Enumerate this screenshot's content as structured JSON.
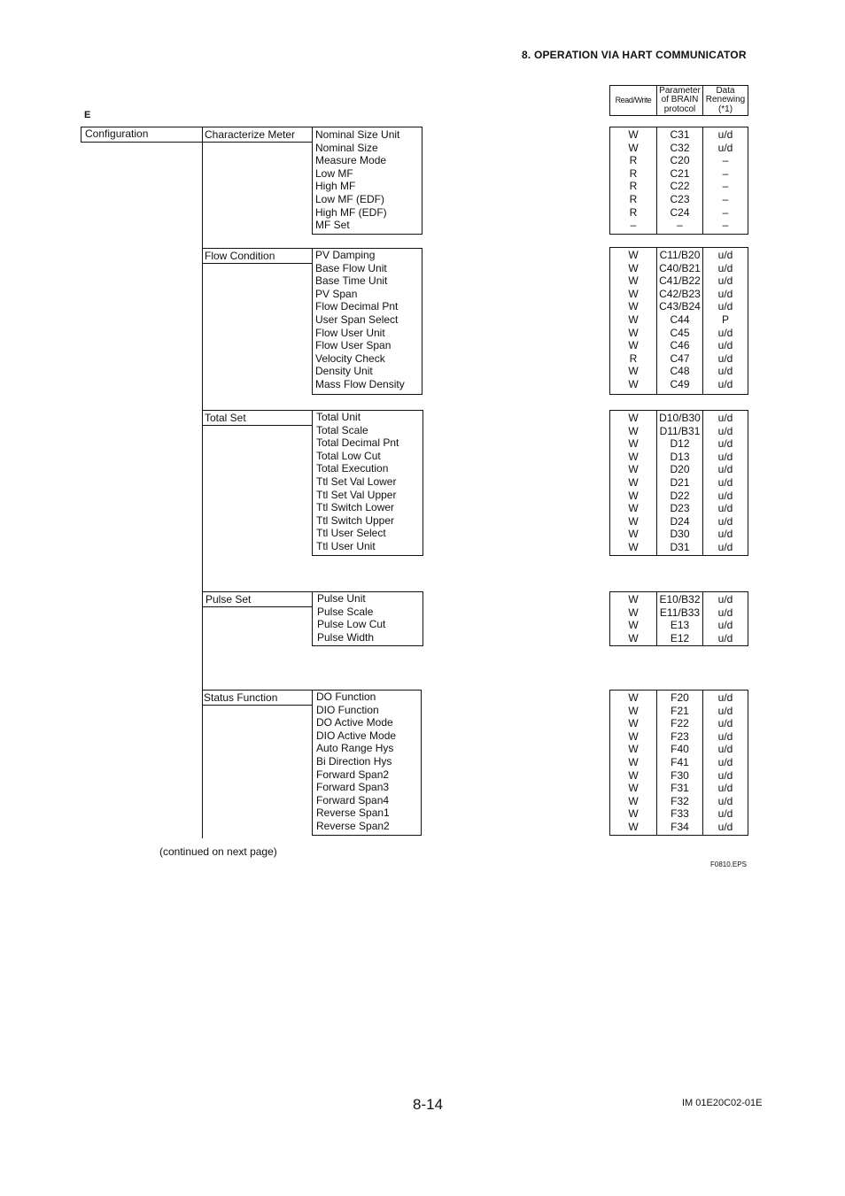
{
  "header": {
    "title": "8.  OPERATION VIA HART COMMUNICATOR"
  },
  "section_mark": "E",
  "table_header": {
    "read_write": "Read/Write",
    "brain_param": "Parameter of BRAIN protocol",
    "data_renewing": "Data Renewing (*1)"
  },
  "root": {
    "label": "Configuration"
  },
  "groups": [
    {
      "label": "Characterize Meter",
      "items": [
        "Nominal Size Unit",
        "Nominal Size",
        "Measure Mode",
        "Low MF",
        "High MF",
        "Low MF (EDF)",
        "High MF (EDF)",
        "MF Set"
      ],
      "rw": [
        "W",
        "W",
        "R",
        "R",
        "R",
        "R",
        "R",
        "–"
      ],
      "param": [
        "C31",
        "C32",
        "C20",
        "C21",
        "C22",
        "C23",
        "C24",
        "–"
      ],
      "renew": [
        "u/d",
        "u/d",
        "–",
        "–",
        "–",
        "–",
        "–",
        "–"
      ]
    },
    {
      "label": "Flow Condition",
      "items": [
        "PV Damping",
        "Base Flow Unit",
        "Base Time Unit",
        "PV Span",
        "Flow Decimal Pnt",
        "User Span Select",
        "Flow User Unit",
        "Flow User Span",
        "Velocity Check",
        "Density Unit",
        "Mass Flow Density"
      ],
      "rw": [
        "W",
        "W",
        "W",
        "W",
        "W",
        "W",
        "W",
        "W",
        "R",
        "W",
        "W"
      ],
      "param": [
        "C11/B20",
        "C40/B21",
        "C41/B22",
        "C42/B23",
        "C43/B24",
        "C44",
        "C45",
        "C46",
        "C47",
        "C48",
        "C49"
      ],
      "renew": [
        "u/d",
        "u/d",
        "u/d",
        "u/d",
        "u/d",
        "P",
        "u/d",
        "u/d",
        "u/d",
        "u/d",
        "u/d"
      ]
    },
    {
      "label": "Total Set",
      "items": [
        "Total Unit",
        "Total Scale",
        "Total Decimal Pnt",
        "Total Low Cut",
        "Total Execution",
        "Ttl Set Val Lower",
        "Ttl Set Val Upper",
        "Ttl Switch Lower",
        "Ttl Switch Upper",
        "Ttl User Select",
        "Ttl User Unit"
      ],
      "rw": [
        "W",
        "W",
        "W",
        "W",
        "W",
        "W",
        "W",
        "W",
        "W",
        "W",
        "W"
      ],
      "param": [
        "D10/B30",
        "D11/B31",
        "D12",
        "D13",
        "D20",
        "D21",
        "D22",
        "D23",
        "D24",
        "D30",
        "D31"
      ],
      "renew": [
        "u/d",
        "u/d",
        "u/d",
        "u/d",
        "u/d",
        "u/d",
        "u/d",
        "u/d",
        "u/d",
        "u/d",
        "u/d"
      ]
    },
    {
      "label": "Pulse Set",
      "items": [
        "Pulse Unit",
        "Pulse Scale",
        "Pulse Low Cut",
        "Pulse Width"
      ],
      "rw": [
        "W",
        "W",
        "W",
        "W"
      ],
      "param": [
        "E10/B32",
        "E11/B33",
        "E13",
        "E12"
      ],
      "renew": [
        "u/d",
        "u/d",
        "u/d",
        "u/d"
      ]
    },
    {
      "label": "Status Function",
      "items": [
        "DO Function",
        "DIO Function",
        "DO Active Mode",
        "DIO Active Mode",
        "Auto Range Hys",
        "Bi Direction Hys",
        "Forward Span2",
        "Forward Span3",
        "Forward Span4",
        "Reverse Span1",
        "Reverse Span2"
      ],
      "rw": [
        "W",
        "W",
        "W",
        "W",
        "W",
        "W",
        "W",
        "W",
        "W",
        "W",
        "W"
      ],
      "param": [
        "F20",
        "F21",
        "F22",
        "F23",
        "F40",
        "F41",
        "F30",
        "F31",
        "F32",
        "F33",
        "F34"
      ],
      "renew": [
        "u/d",
        "u/d",
        "u/d",
        "u/d",
        "u/d",
        "u/d",
        "u/d",
        "u/d",
        "u/d",
        "u/d",
        "u/d"
      ]
    }
  ],
  "continued": "(continued on next page)",
  "figure_id": "F0810.EPS",
  "page_number": "8-14",
  "doc_id": "IM 01E20C02-01E"
}
